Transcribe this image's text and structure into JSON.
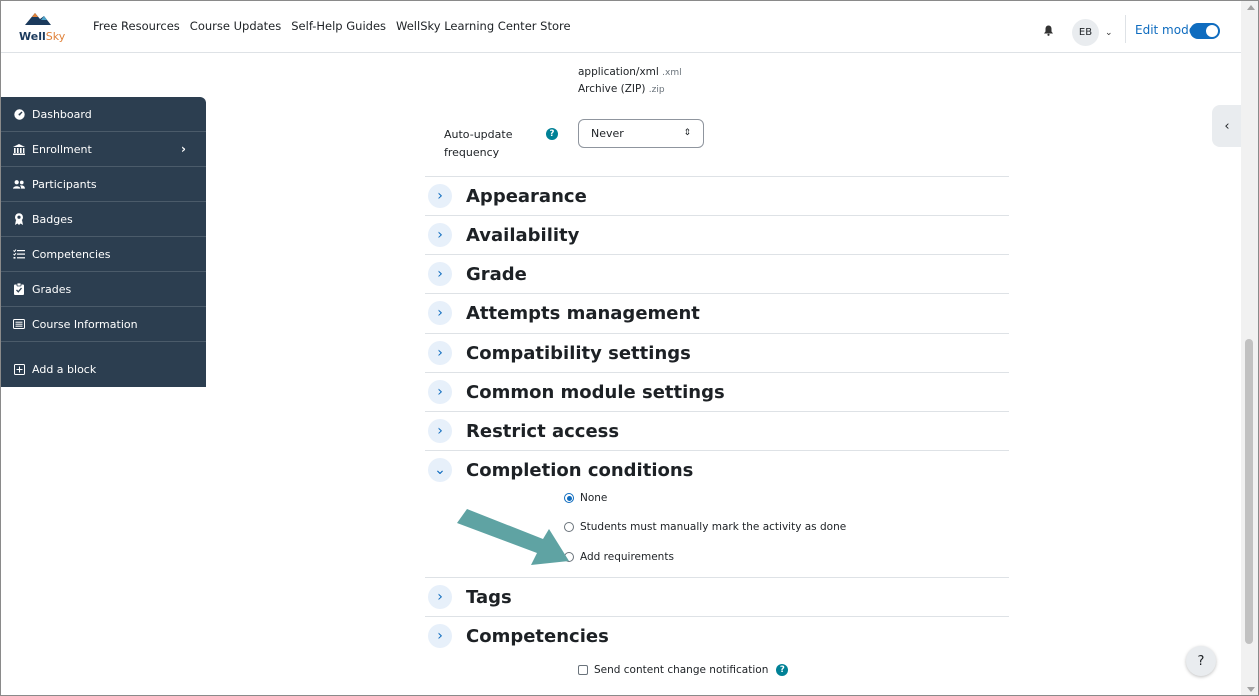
{
  "brand": {
    "name_main": "Well",
    "name_accent": "Sky"
  },
  "nav": {
    "links": [
      "Free Resources",
      "Course Updates",
      "Self-Help Guides",
      "WellSky Learning Center Store"
    ],
    "avatar_initials": "EB",
    "edit_mode_label": "Edit mode",
    "edit_mode_on": true,
    "icons": {
      "notifications": "bell-icon",
      "user_menu": "chevron-down-icon"
    }
  },
  "drawer": {
    "items": [
      {
        "label": "Dashboard",
        "icon": "dashboard-icon"
      },
      {
        "label": "Enrollment",
        "icon": "institution-icon",
        "arrow": "›"
      },
      {
        "label": "Participants",
        "icon": "users-icon"
      },
      {
        "label": "Badges",
        "icon": "badge-icon"
      },
      {
        "label": "Competencies",
        "icon": "list-icon"
      },
      {
        "label": "Grades",
        "icon": "grades-icon"
      },
      {
        "label": "Course Information",
        "icon": "card-icon"
      },
      {
        "label": "Add a block",
        "icon": "plus-square-icon"
      }
    ]
  },
  "filetypes": [
    {
      "name": "application/xml",
      "ext": ".xml"
    },
    {
      "name": "Archive (ZIP)",
      "ext": ".zip"
    }
  ],
  "auto_update": {
    "label": "Auto-update frequency",
    "value": "Never"
  },
  "sections": [
    "Appearance",
    "Availability",
    "Grade",
    "Attempts management",
    "Compatibility settings",
    "Common module settings",
    "Restrict access",
    "Completion conditions",
    "Tags",
    "Competencies"
  ],
  "completion": {
    "options": [
      "None",
      "Students must manually mark the activity as done",
      "Add requirements"
    ],
    "selected_index": 0
  },
  "notification_label": "Send content change notification",
  "colors": {
    "accent": "#0f6cbf",
    "drawer": "#2c3e50",
    "help": "#008196",
    "pointer_arrow": "#5fa3a3"
  }
}
